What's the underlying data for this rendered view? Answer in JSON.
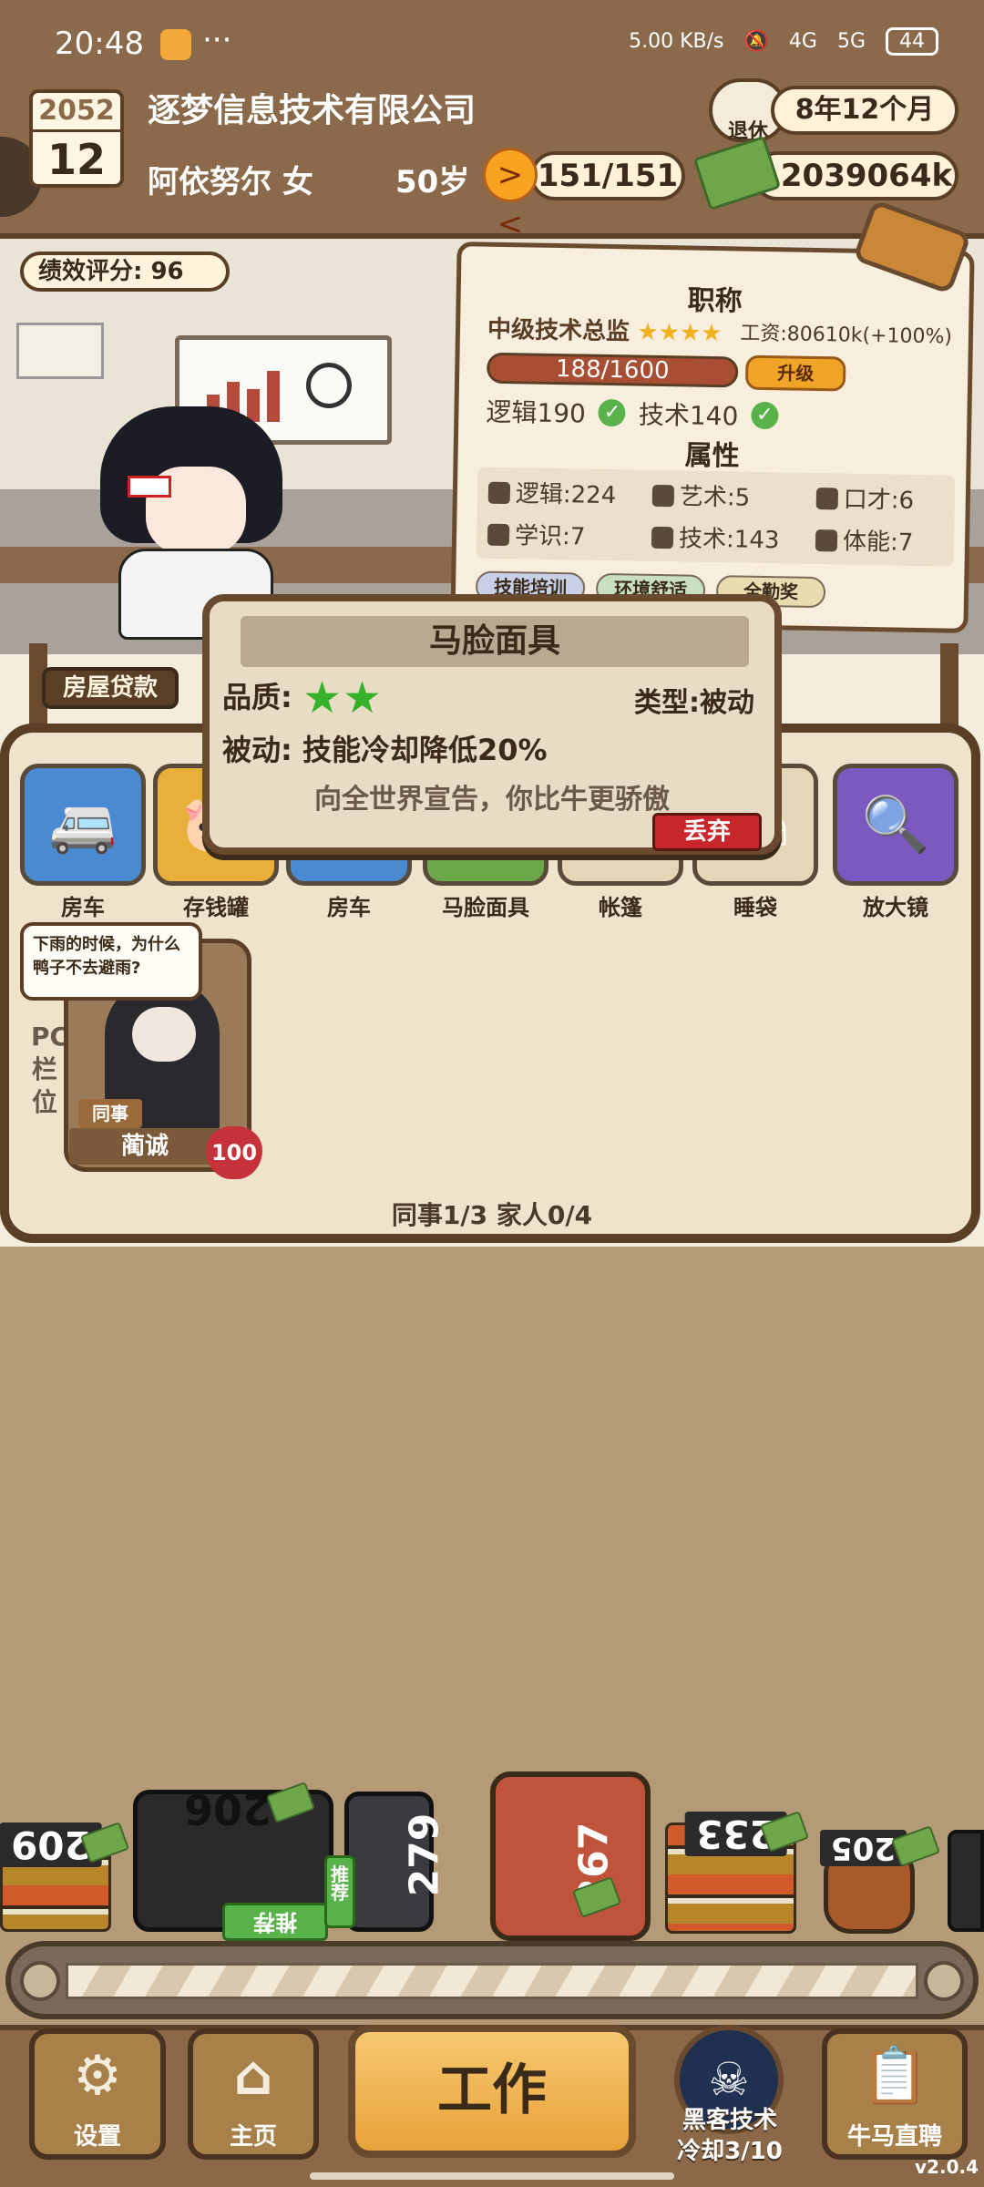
{
  "status_bar": {
    "time": "20:48",
    "dots": "···",
    "net_speed": "5.00 KB/s",
    "signal_4g": "4G",
    "signal_5g": "5G",
    "battery": "44"
  },
  "header": {
    "year": "2052",
    "month": "12",
    "company": "逐梦信息技术有限公司",
    "player_name": "阿依努尔 女",
    "player_age": "50岁",
    "hp": "151/151",
    "money": "2039064k",
    "retire_label": "退休",
    "retire_time": "8年12个月"
  },
  "scene": {
    "performance": "绩效评分: 96"
  },
  "job": {
    "title_header": "职称",
    "title": "中级技术总监",
    "stars": "★★★★",
    "salary": "工资:80610k(+100%)",
    "xp": "188/1600",
    "upgrade": "升级",
    "req_logic": "逻辑190",
    "req_tech": "技术140",
    "attr_header": "属性",
    "attrs": {
      "logic": "逻辑:224",
      "art": "艺术:5",
      "eloquence": "口才:6",
      "knowledge": "学识:7",
      "tech": "技术:143",
      "stamina": "体能:7"
    },
    "perks": [
      "技能培训",
      "环境舒适",
      "全勤奖"
    ]
  },
  "assets": {
    "mortgage": "房屋贷款",
    "items": [
      {
        "label": "房车",
        "color": "#4a8ad0"
      },
      {
        "label": "存钱罐",
        "color": "#e8b03a"
      },
      {
        "label": "房车",
        "color": "#4a8ad0"
      },
      {
        "label": "马脸面具",
        "color": "#6aa84a"
      },
      {
        "label": "帐篷",
        "color": "#e6d6b8"
      },
      {
        "label": "睡袋",
        "color": "#e6d6b8"
      },
      {
        "label": "放大镜",
        "color": "#7a5ac0"
      }
    ]
  },
  "popup": {
    "title": "马脸面具",
    "quality_label": "品质:",
    "quality_stars": 2,
    "type": "类型:被动",
    "passive": "被动: 技能冷却降低20%",
    "desc": "向全世界宣告，你比牛更骄傲",
    "discard": "丢弃"
  },
  "npc": {
    "slot_label": "PC栏位",
    "bubble": "下雨的时候，为什么鸭子不去避雨?",
    "tag": "同事",
    "name": "蔺诚",
    "affinity": "100",
    "count": "同事1/3 家人0/4"
  },
  "conveyor": {
    "values": [
      "209",
      "206",
      "279",
      "267",
      "233",
      "205"
    ],
    "recommend": "推荐"
  },
  "nav": {
    "settings": "设置",
    "home": "主页",
    "work": "工作",
    "hacker": "黑客技术",
    "cooldown": "冷却3/10",
    "recruit": "牛马直聘",
    "version": "v2.0.4"
  },
  "colors": {
    "wood_dark": "#5a3e26",
    "panel": "#f7eede",
    "accent_orange": "#f0a428",
    "star_green": "#36b22a",
    "discard_red": "#c8262a"
  }
}
